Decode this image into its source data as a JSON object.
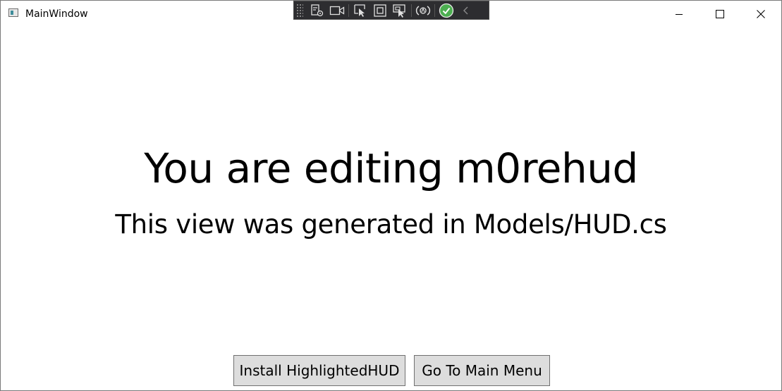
{
  "window": {
    "title": "MainWindow"
  },
  "debug_toolbar": {
    "tools": [
      {
        "icon": "live-visual-tree-icon"
      },
      {
        "icon": "camera-icon"
      },
      {
        "icon": "select-element-icon"
      },
      {
        "icon": "display-layout-adorners-icon"
      },
      {
        "icon": "track-focused-element-icon"
      },
      {
        "icon": "hot-reload-icon"
      },
      {
        "icon": "binding-check-icon"
      },
      {
        "icon": "collapse-chevron-icon"
      }
    ]
  },
  "main": {
    "heading": "You are editing m0rehud",
    "subheading": "This view was generated in Models/HUD.cs"
  },
  "actions": {
    "install_label": "Install HighlightedHUD",
    "menu_label": "Go To Main Menu"
  },
  "colors": {
    "button_bg": "#dddddd",
    "button_border": "#707070",
    "debugbar_bg": "#2d2d30",
    "check_green": "#4caf50"
  }
}
